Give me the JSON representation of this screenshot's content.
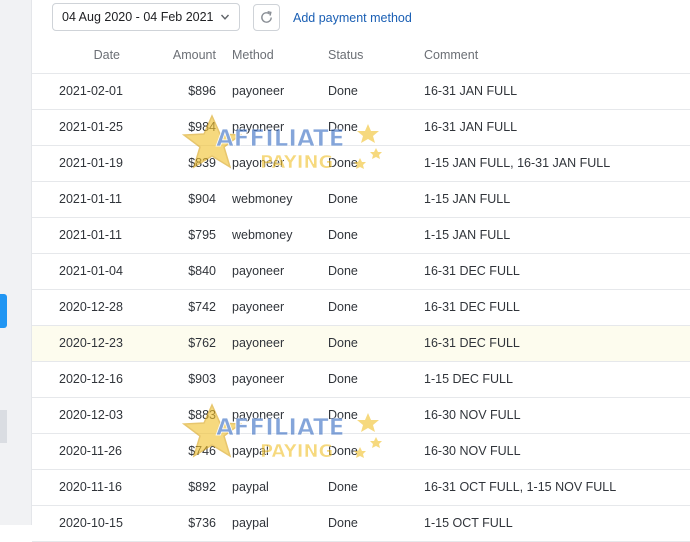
{
  "toolbar": {
    "date_range": "04 Aug 2020 - 04 Feb 2021",
    "add_payment_label": "Add payment method"
  },
  "table": {
    "headers": {
      "date": "Date",
      "amount": "Amount",
      "method": "Method",
      "status": "Status",
      "comment": "Comment"
    },
    "rows": [
      {
        "date": "2021-02-01",
        "amount": "$896",
        "method": "payoneer",
        "status": "Done",
        "comment": "16-31 JAN FULL"
      },
      {
        "date": "2021-01-25",
        "amount": "$984",
        "method": "payoneer",
        "status": "Done",
        "comment": "16-31 JAN FULL"
      },
      {
        "date": "2021-01-19",
        "amount": "$839",
        "method": "payoneer",
        "status": "Done",
        "comment": "1-15 JAN FULL, 16-31 JAN FULL"
      },
      {
        "date": "2021-01-11",
        "amount": "$904",
        "method": "webmoney",
        "status": "Done",
        "comment": "1-15 JAN FULL"
      },
      {
        "date": "2021-01-11",
        "amount": "$795",
        "method": "webmoney",
        "status": "Done",
        "comment": "1-15 JAN FULL"
      },
      {
        "date": "2021-01-04",
        "amount": "$840",
        "method": "payoneer",
        "status": "Done",
        "comment": "16-31 DEC FULL"
      },
      {
        "date": "2020-12-28",
        "amount": "$742",
        "method": "payoneer",
        "status": "Done",
        "comment": "16-31 DEC FULL"
      },
      {
        "date": "2020-12-23",
        "amount": "$762",
        "method": "payoneer",
        "status": "Done",
        "comment": "16-31 DEC FULL"
      },
      {
        "date": "2020-12-16",
        "amount": "$903",
        "method": "payoneer",
        "status": "Done",
        "comment": "1-15 DEC FULL"
      },
      {
        "date": "2020-12-03",
        "amount": "$883",
        "method": "payoneer",
        "status": "Done",
        "comment": "16-30 NOV FULL"
      },
      {
        "date": "2020-11-26",
        "amount": "$746",
        "method": "paypal",
        "status": "Done",
        "comment": "16-30 NOV FULL"
      },
      {
        "date": "2020-11-16",
        "amount": "$892",
        "method": "paypal",
        "status": "Done",
        "comment": "16-31 OCT FULL, 1-15 NOV FULL"
      },
      {
        "date": "2020-10-15",
        "amount": "$736",
        "method": "paypal",
        "status": "Done",
        "comment": "1-15 OCT FULL"
      }
    ]
  },
  "watermark": {
    "line1": "AFFILIATE",
    "line2": "PAYING"
  },
  "icons": {
    "date_dropdown": "chevron-down-icon",
    "refresh": "refresh-icon",
    "watermark": "star-logo-icon"
  },
  "colors": {
    "link": "#1a5fb4",
    "accent": "#2196f3",
    "row_highlight": "#fdfcee",
    "watermark_gold": "#f2c230",
    "watermark_blue": "#3a6fc4"
  }
}
